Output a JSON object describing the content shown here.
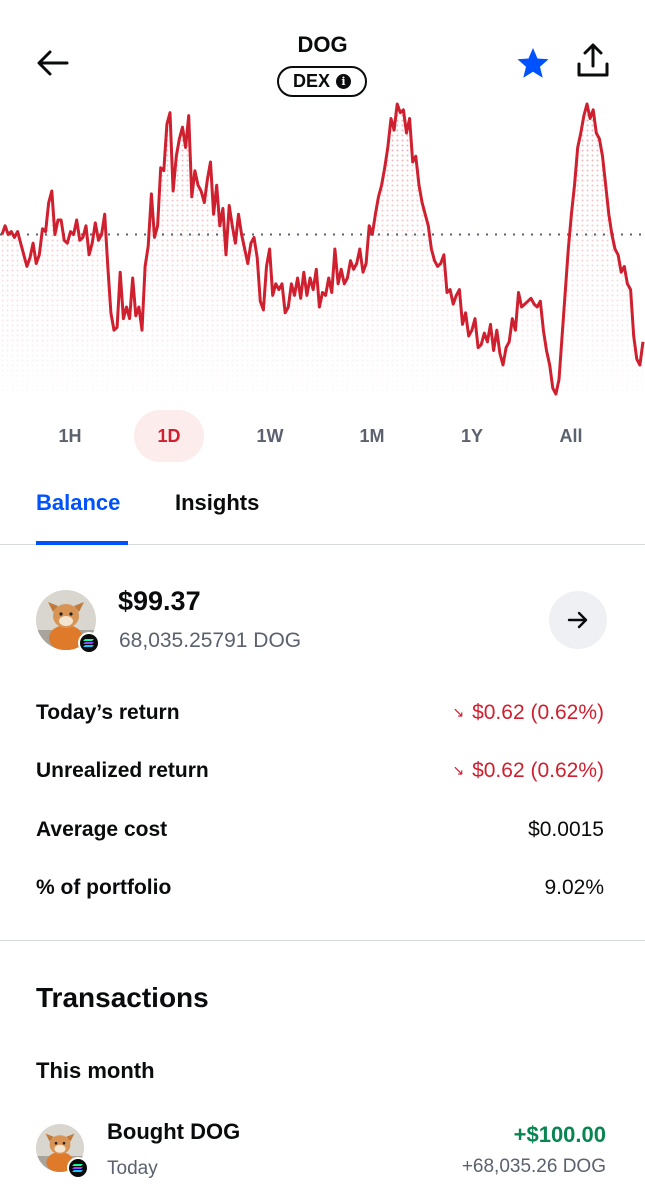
{
  "header": {
    "title": "DOG",
    "badge": "DEX",
    "info_icon": "info-icon",
    "back_icon": "arrow-left-icon",
    "star_icon": "star-icon",
    "share_icon": "share-icon",
    "accent_color": "#0052ff"
  },
  "chart": {
    "type": "line",
    "line_color": "#cf202f",
    "reference_line": "dotted",
    "series": [
      0.55,
      0.58,
      0.55,
      0.56,
      0.54,
      0.56,
      0.52,
      0.48,
      0.44,
      0.47,
      0.52,
      0.45,
      0.48,
      0.57,
      0.56,
      0.66,
      0.7,
      0.55,
      0.6,
      0.6,
      0.53,
      0.52,
      0.56,
      0.55,
      0.6,
      0.53,
      0.54,
      0.58,
      0.48,
      0.52,
      0.59,
      0.53,
      0.55,
      0.62,
      0.44,
      0.28,
      0.22,
      0.23,
      0.42,
      0.26,
      0.3,
      0.26,
      0.4,
      0.27,
      0.3,
      0.22,
      0.44,
      0.51,
      0.69,
      0.54,
      0.58,
      0.78,
      0.77,
      0.93,
      0.97,
      0.7,
      0.82,
      0.88,
      0.92,
      0.85,
      0.96,
      0.68,
      0.77,
      0.72,
      0.7,
      0.66,
      0.74,
      0.8,
      0.62,
      0.72,
      0.58,
      0.64,
      0.48,
      0.65,
      0.58,
      0.52,
      0.62,
      0.55,
      0.5,
      0.45,
      0.52,
      0.54,
      0.47,
      0.32,
      0.29,
      0.44,
      0.5,
      0.34,
      0.38,
      0.36,
      0.38,
      0.28,
      0.3,
      0.38,
      0.34,
      0.4,
      0.33,
      0.42,
      0.34,
      0.4,
      0.36,
      0.43,
      0.3,
      0.35,
      0.34,
      0.4,
      0.35,
      0.5,
      0.38,
      0.43,
      0.38,
      0.4,
      0.46,
      0.43,
      0.45,
      0.5,
      0.42,
      0.45,
      0.58,
      0.55,
      0.62,
      0.68,
      0.72,
      0.78,
      0.85,
      0.95,
      0.91,
      1.0,
      0.97,
      0.98,
      0.9,
      0.95,
      0.8,
      0.82,
      0.72,
      0.66,
      0.62,
      0.58,
      0.5,
      0.46,
      0.44,
      0.45,
      0.48,
      0.35,
      0.36,
      0.31,
      0.34,
      0.36,
      0.24,
      0.28,
      0.2,
      0.22,
      0.26,
      0.16,
      0.17,
      0.21,
      0.18,
      0.24,
      0.15,
      0.22,
      0.14,
      0.1,
      0.16,
      0.18,
      0.26,
      0.22,
      0.35,
      0.3,
      0.31,
      0.32,
      0.33,
      0.31,
      0.3,
      0.32,
      0.22,
      0.15,
      0.1,
      0.02,
      0.0,
      0.05,
      0.2,
      0.35,
      0.5,
      0.62,
      0.72,
      0.85,
      0.9,
      0.96,
      1.0,
      0.95,
      0.98,
      0.9,
      0.88,
      0.82,
      0.72,
      0.62,
      0.55,
      0.5,
      0.48,
      0.42,
      0.44,
      0.38,
      0.36,
      0.2,
      0.12,
      0.1,
      0.18
    ]
  },
  "ranges": {
    "selected": "1D",
    "items": [
      "1H",
      "1D",
      "1W",
      "1M",
      "1Y",
      "All"
    ]
  },
  "tabs": {
    "balance": "Balance",
    "insights": "Insights"
  },
  "balance": {
    "amount": "$99.37",
    "quantity": "68,035.25791 DOG",
    "next_icon": "arrow-right-icon",
    "stats": [
      {
        "label": "Today’s return",
        "value": "$0.62 (0.62%)",
        "trend": "down"
      },
      {
        "label": "Unrealized return",
        "value": "$0.62 (0.62%)",
        "trend": "down"
      },
      {
        "label": "Average cost",
        "value": "$0.0015"
      },
      {
        "label": "% of portfolio",
        "value": "9.02%"
      }
    ],
    "down_arrow": "↘",
    "negative_color": "#cf202f"
  },
  "transactions": {
    "title": "Transactions",
    "group": "This month",
    "items": [
      {
        "name": "Bought DOG",
        "date": "Today",
        "amount": "+$100.00",
        "quantity": "+68,035.26 DOG"
      }
    ],
    "positive_color": "#098551"
  }
}
